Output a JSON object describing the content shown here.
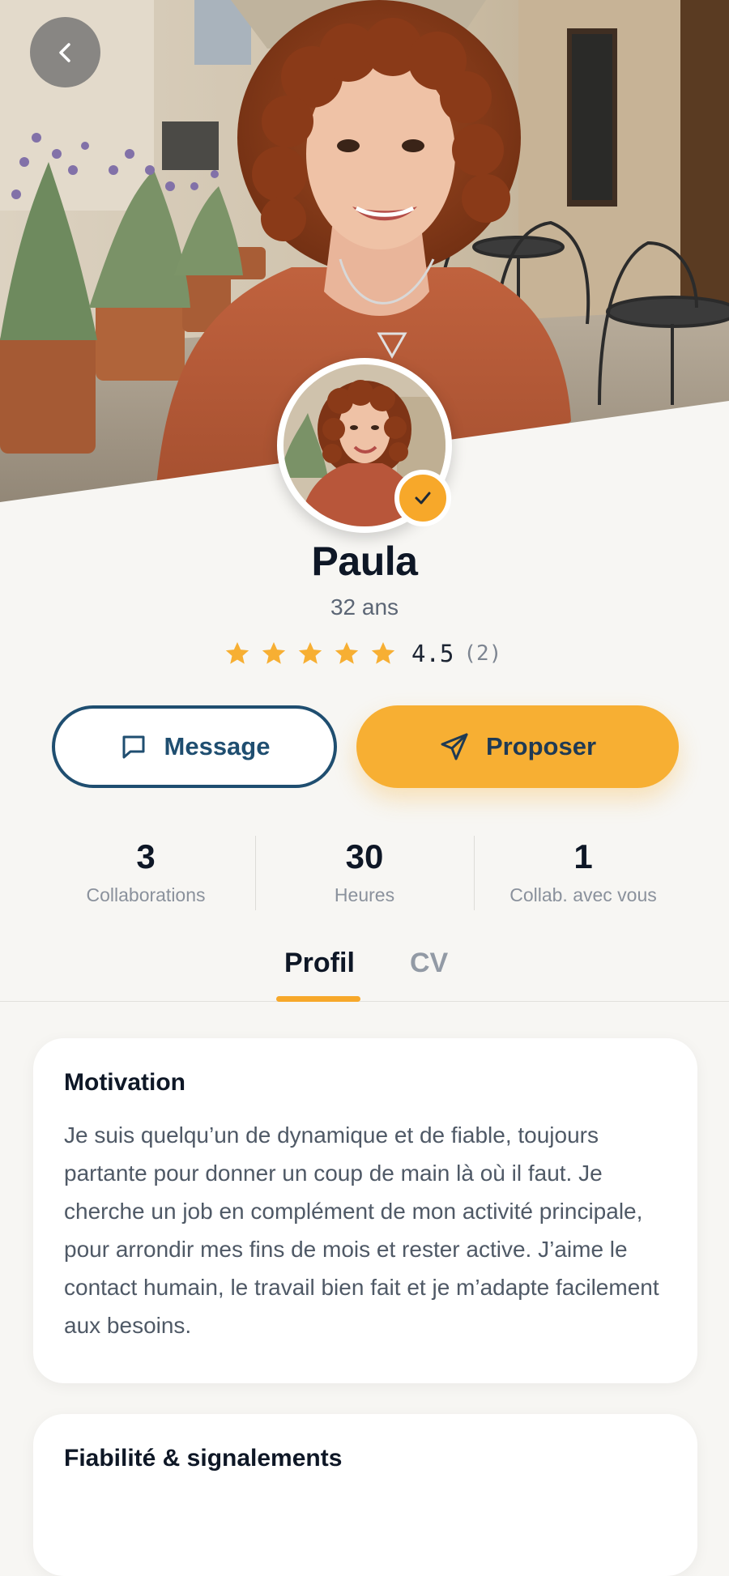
{
  "header": {
    "back_icon": "chevron-left-icon"
  },
  "profile": {
    "name": "Paula",
    "age": "32 ans",
    "verified_icon": "check-icon",
    "rating": {
      "value": "4.5",
      "count": "(2)",
      "stars": 5,
      "star_color": "#F7AF33"
    }
  },
  "actions": {
    "message_label": "Message",
    "message_icon": "chat-bubble-icon",
    "propose_label": "Proposer",
    "propose_icon": "send-icon"
  },
  "stats": [
    {
      "value": "3",
      "label": "Collaborations"
    },
    {
      "value": "30",
      "label": "Heures"
    },
    {
      "value": "1",
      "label": "Collab. avec vous"
    }
  ],
  "tabs": [
    {
      "label": "Profil",
      "active": true
    },
    {
      "label": "CV",
      "active": false
    }
  ],
  "motivation": {
    "title": "Motivation",
    "text": "Je suis quelqu’un de dynamique et de fiable, toujours partante pour donner un coup de main là où il faut. Je cherche un job en complément de mon activité principale, pour arrondir mes fins de mois et rester active. J’aime le contact humain, le travail bien fait et je m’adapte facilement aux besoins."
  },
  "fiabilite": {
    "title": "Fiabilité & signalements"
  },
  "colors": {
    "accent": "#F7AF33",
    "primary": "#1F4E70",
    "background": "#F7F6F3"
  }
}
